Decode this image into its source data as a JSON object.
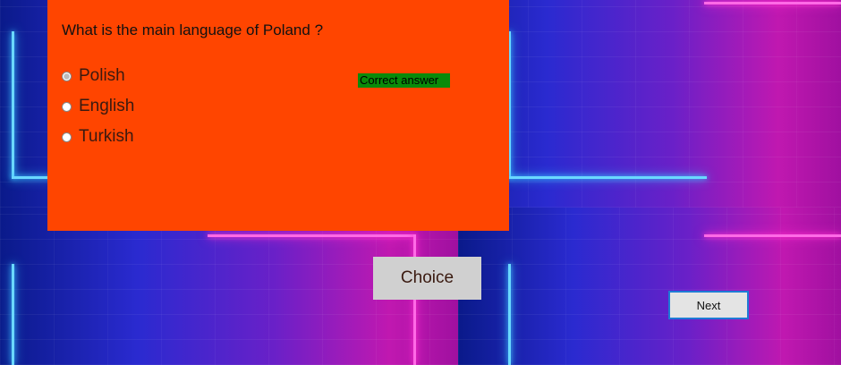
{
  "quiz": {
    "question": "What is the main language of Poland ?",
    "options": [
      {
        "label": "Polish",
        "selected": true
      },
      {
        "label": "English",
        "selected": false
      },
      {
        "label": "Turkish",
        "selected": false
      }
    ],
    "feedback": "Correct answer",
    "feedback_color": "#0a8a0a",
    "panel_color": "#ff4500"
  },
  "buttons": {
    "choice": "Choice",
    "next": "Next"
  }
}
